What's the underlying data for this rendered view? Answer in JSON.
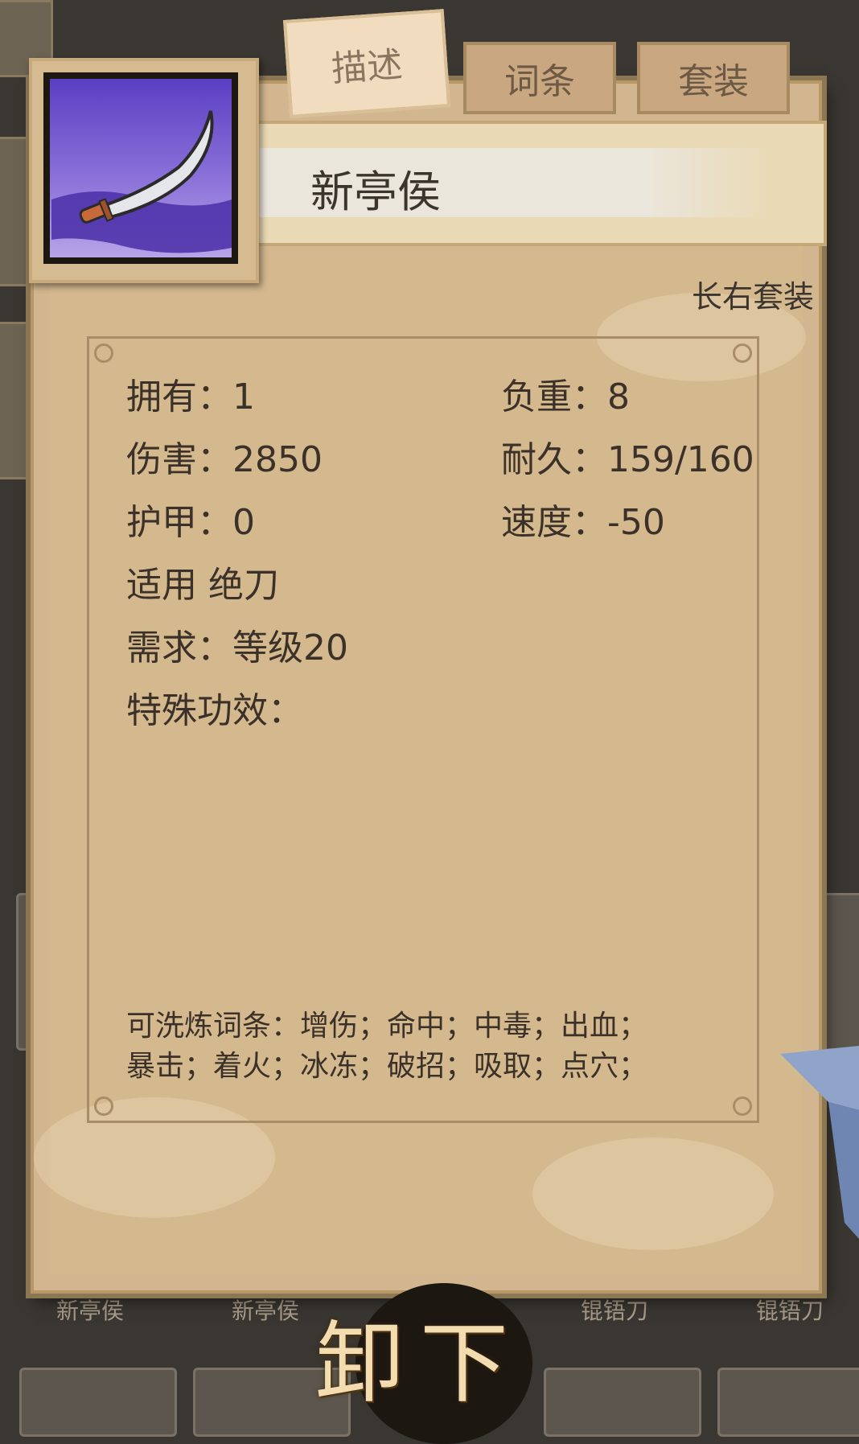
{
  "tabs": [
    {
      "label": "描述",
      "active": true
    },
    {
      "label": "词条",
      "active": false
    },
    {
      "label": "套装",
      "active": false
    }
  ],
  "item": {
    "name": "新亭侯",
    "icon": "blade-icon",
    "set_name": "长右套装"
  },
  "stats": {
    "owned": "拥有：1",
    "weight": "负重：8",
    "damage": "伤害：2850",
    "durability": "耐久：159/160",
    "armor": "护甲：0",
    "speed": "速度：-50",
    "applicable": "适用 绝刀",
    "requirement": "需求：等级20",
    "special": "特殊功效："
  },
  "reroll": {
    "line1": "可洗炼词条：增伤；命中；中毒；出血；",
    "line2": "暴击；着火；冰冻；破招；吸取；点穴；"
  },
  "background_items": [
    "新亭侯",
    "新亭侯",
    "锟铻刀",
    "锟铻刀"
  ],
  "unequip_label": "卸下",
  "colors": {
    "panel": "#d2b68f",
    "tab_active": "#f1dcc0",
    "tab_inactive": "#c9a780",
    "text": "#3b3128",
    "icon_bg": "#6a50cc"
  }
}
